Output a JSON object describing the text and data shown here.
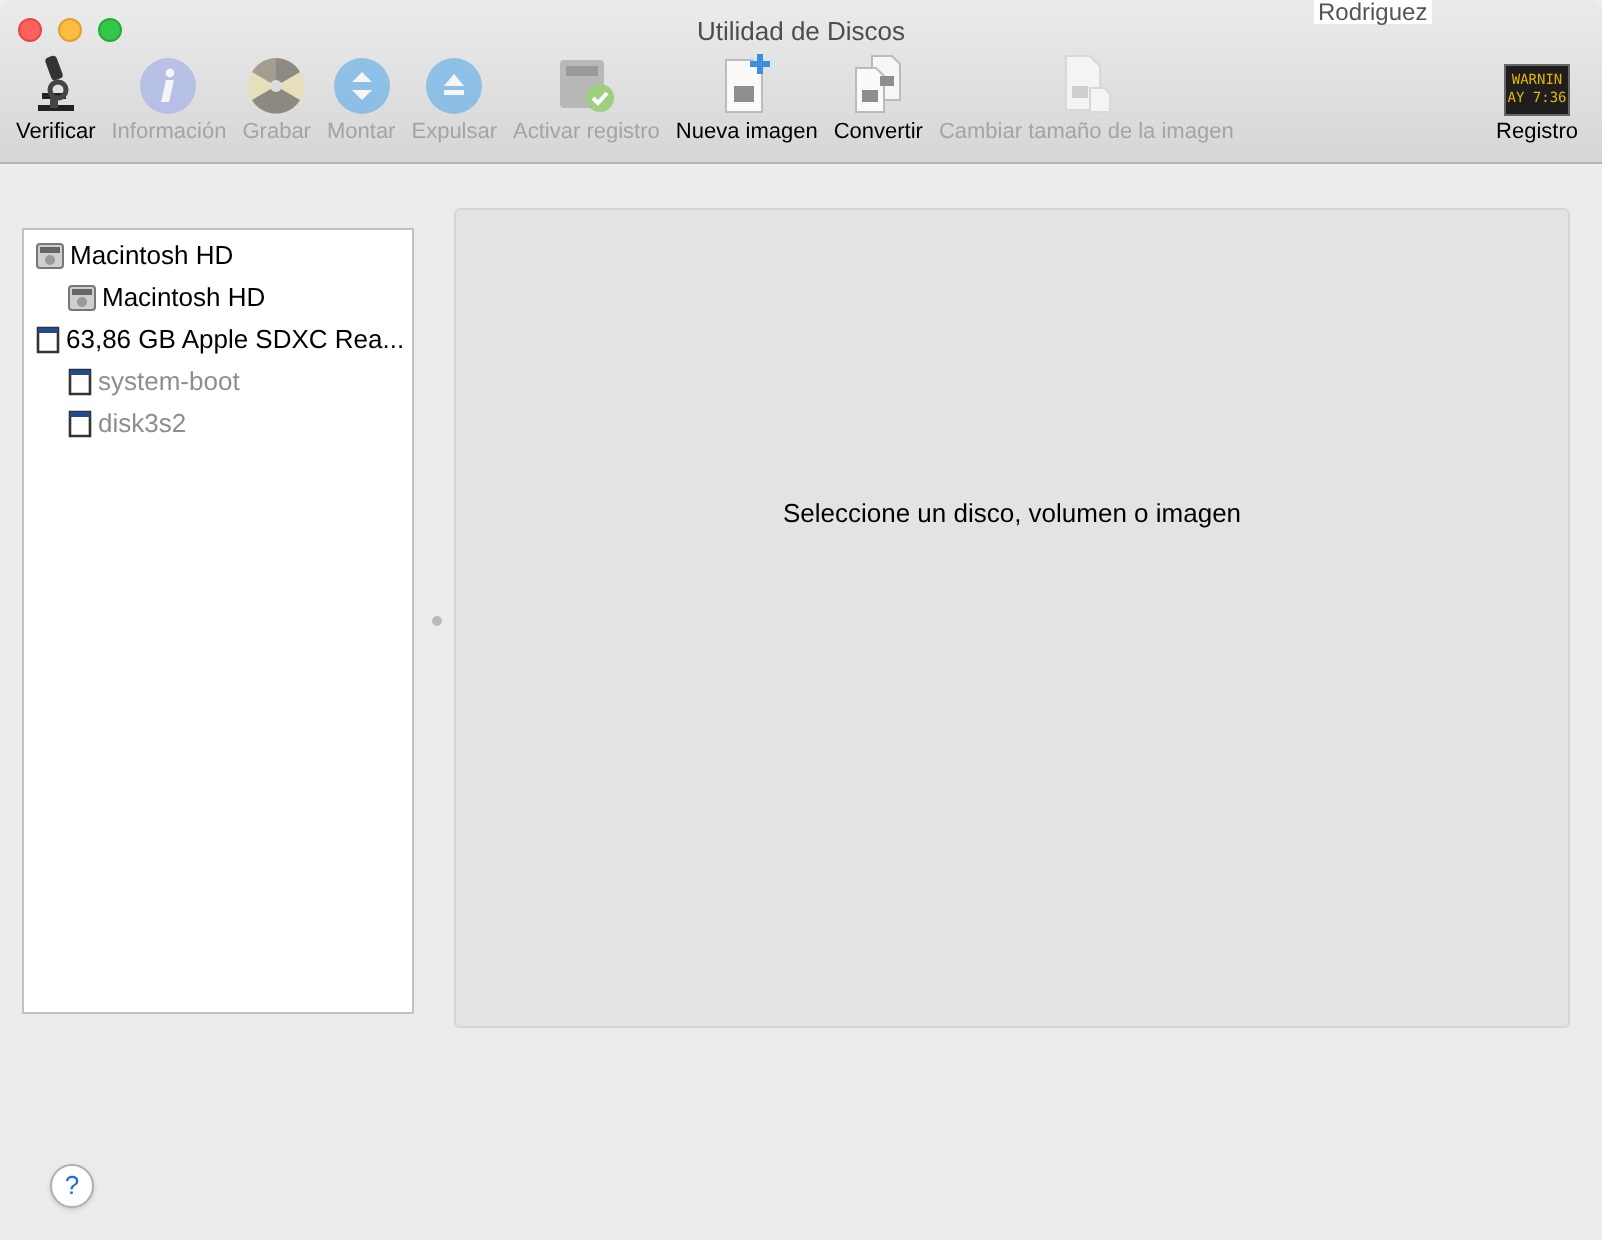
{
  "background_window": {
    "text": "Rodriguez"
  },
  "window": {
    "title": "Utilidad de Discos"
  },
  "toolbar": [
    {
      "label": "Verificar",
      "kind": "microscope",
      "disabled": false
    },
    {
      "label": "Información",
      "kind": "info",
      "disabled": true
    },
    {
      "label": "Grabar",
      "kind": "burn",
      "disabled": true
    },
    {
      "label": "Montar",
      "kind": "mount",
      "disabled": true
    },
    {
      "label": "Expulsar",
      "kind": "eject",
      "disabled": true
    },
    {
      "label": "Activar registro",
      "kind": "journal",
      "disabled": true
    },
    {
      "label": "Nueva imagen",
      "kind": "newimage",
      "disabled": false
    },
    {
      "label": "Convertir",
      "kind": "convert",
      "disabled": false
    },
    {
      "label": "Cambiar tamaño de la imagen",
      "kind": "resize",
      "disabled": true
    },
    {
      "label": "Registro",
      "kind": "log",
      "disabled": false,
      "icon_text": [
        "WARNIN",
        "AY 7:36"
      ]
    }
  ],
  "sidebar": {
    "items": [
      {
        "label": "Macintosh HD",
        "kind": "hd",
        "dimmed": false,
        "children": [
          {
            "label": "Macintosh HD",
            "kind": "hd",
            "dimmed": false
          }
        ]
      },
      {
        "label": "63,86 GB Apple SDXC Rea...",
        "kind": "sd",
        "dimmed": false,
        "children": [
          {
            "label": "system-boot",
            "kind": "sd",
            "dimmed": true
          },
          {
            "label": "disk3s2",
            "kind": "sd",
            "dimmed": true
          }
        ]
      }
    ]
  },
  "main": {
    "message": "Seleccione un disco, volumen o imagen"
  },
  "help_button": {
    "label": "?"
  }
}
